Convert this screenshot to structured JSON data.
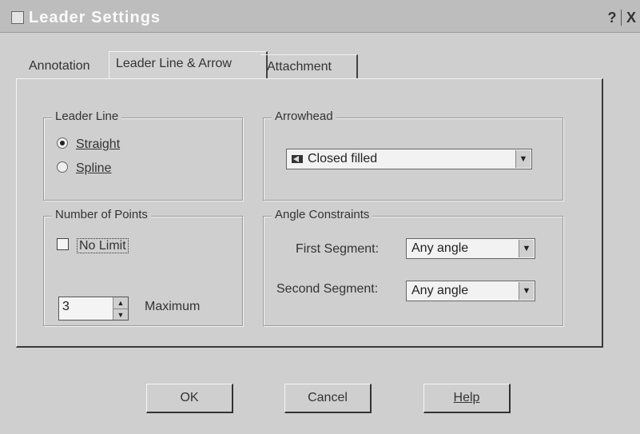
{
  "window": {
    "title": "Leader Settings",
    "help_glyph": "?",
    "close_glyph": "X"
  },
  "tabs": [
    {
      "label": "Annotation"
    },
    {
      "label": "Leader Line & Arrow"
    },
    {
      "label": "Attachment"
    }
  ],
  "leader_line": {
    "title": "Leader Line",
    "options": [
      {
        "label": "Straight",
        "selected": true
      },
      {
        "label": "Spline",
        "selected": false
      }
    ]
  },
  "arrowhead": {
    "title": "Arrowhead",
    "selected": "Closed filled"
  },
  "number_of_points": {
    "title": "Number of Points",
    "no_limit_label": "No Limit",
    "no_limit_checked": false,
    "maximum_value": "3",
    "maximum_label": "Maximum"
  },
  "angle_constraints": {
    "title": "Angle Constraints",
    "first_segment_label": "First Segment:",
    "first_segment_value": "Any angle",
    "second_segment_label": "Second Segment:",
    "second_segment_value": "Any angle"
  },
  "buttons": {
    "ok": "OK",
    "cancel": "Cancel",
    "help": "Help"
  }
}
